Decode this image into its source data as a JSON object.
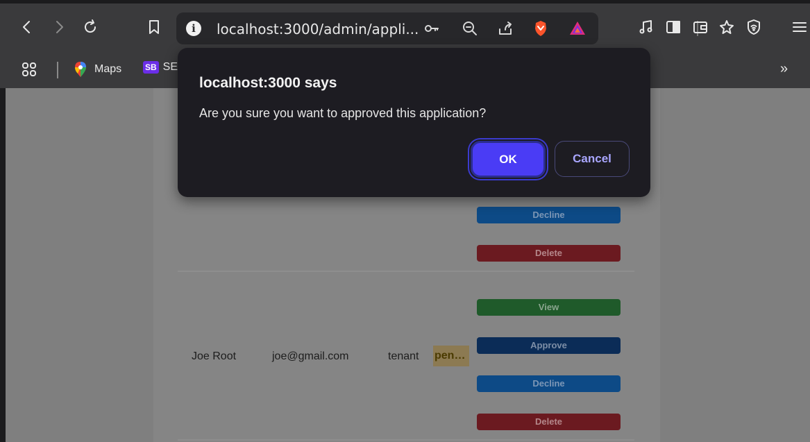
{
  "browser": {
    "url": "localhost:3000/admin/appli...",
    "bookmarks": [
      {
        "label": "Maps"
      },
      {
        "label": "SE",
        "badge": "SB"
      }
    ],
    "overflow_label": "»"
  },
  "dialog": {
    "title": "localhost:3000 says",
    "message": "Are you sure you want to approved this application?",
    "ok_label": "OK",
    "cancel_label": "Cancel"
  },
  "table": {
    "rows": [
      {
        "actions": {
          "decline": "Decline",
          "delete": "Delete"
        }
      },
      {
        "name": "Joe Root",
        "email": "joe@gmail.com",
        "role": "tenant",
        "status": "pen…",
        "actions": {
          "view": "View",
          "approve": "Approve",
          "decline": "Decline",
          "delete": "Delete"
        }
      }
    ]
  },
  "colors": {
    "accent": "#4a3cf5",
    "toolbar": "#3a3a3c",
    "dialog_bg": "#1d1c22"
  }
}
